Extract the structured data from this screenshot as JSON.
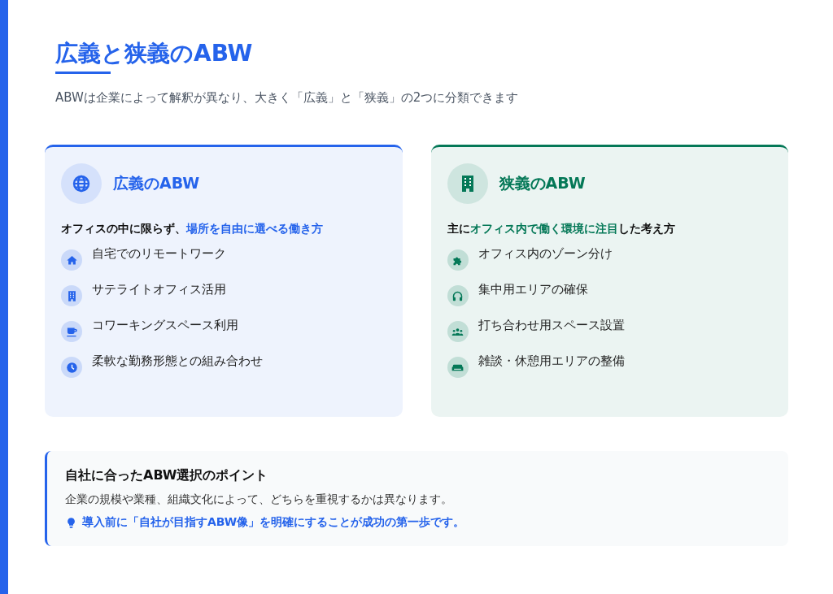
{
  "title": "広義と狭義のABW",
  "lead": "ABWは企業によって解釈が異なり、大きく「広義」と「狭義」の2つに分類できます",
  "cards": [
    {
      "heading": "広義のABW",
      "color": "#2563eb",
      "summary": [
        {
          "text": "オフィスの中に限らず、",
          "highlight": false
        },
        {
          "text": "場所を自由に選べる働き方",
          "highlight": true
        }
      ],
      "items": [
        "自宅でのリモートワーク",
        "サテライトオフィス活用",
        "コワーキングスペース利用",
        "柔軟な勤務形態との組み合わせ"
      ]
    },
    {
      "heading": "狭義のABW",
      "color": "#047857",
      "summary": [
        {
          "text": "主に",
          "highlight": false
        },
        {
          "text": "オフィス内で働く環境に注目",
          "highlight": true
        },
        {
          "text": "した考え方",
          "highlight": false
        }
      ],
      "items": [
        "オフィス内のゾーン分け",
        "集中用エリアの確保",
        "打ち合わせ用スペース設置",
        "雑談・休憩用エリアの整備"
      ]
    }
  ],
  "point": {
    "title": "自社に合ったABW選択のポイント",
    "text": "企業の規模や業種、組織文化によって、どちらを重視するかは異なります。",
    "tip": "導入前に「自社が目指すABW像」を明確にすることが成功の第一歩です。"
  }
}
